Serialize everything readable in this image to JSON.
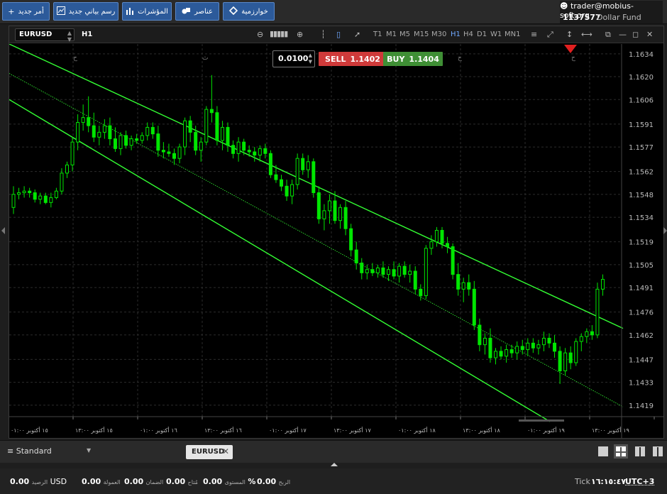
{
  "toolbar": {
    "buttons": [
      {
        "label": "أمر جديد",
        "icon": "+"
      },
      {
        "label": "رسم بياني جديد",
        "icon": "chart"
      },
      {
        "label": "المؤشرات",
        "icon": "bars"
      },
      {
        "label": "عناصر",
        "icon": "shapes"
      },
      {
        "label": "خوارزمية",
        "icon": "diamond"
      }
    ],
    "account_user": "trader@mobius-soft.org",
    "account_number": "1137577",
    "account_fund": "Dollar Fund"
  },
  "chart_window": {
    "symbol": "EURUSD",
    "timeframe": "H1",
    "timeframes": [
      "T1",
      "M1",
      "M5",
      "M15",
      "M30",
      "H1",
      "H4",
      "D1",
      "W1",
      "MN1"
    ],
    "selected_timeframe": "H1",
    "lot_value": "0.0100",
    "sell_label": "SELL",
    "sell_price": "1.1402",
    "buy_label": "BUY",
    "buy_price": "1.1404",
    "top_marks": [
      "ح",
      "ث",
      "ح",
      "ح"
    ]
  },
  "chart_data": {
    "type": "candlestick",
    "price_ticks": [
      "1.1634",
      "1.1620",
      "1.1606",
      "1.1591",
      "1.1577",
      "1.1562",
      "1.1548",
      "1.1534",
      "1.1519",
      "1.1505",
      "1.1491",
      "1.1476",
      "1.1462",
      "1.1447",
      "1.1433",
      "1.1419"
    ],
    "ylim": [
      1.1412,
      1.164
    ],
    "time_labels": [
      "١٥ أكتوبر ٠١:٠٠",
      "١٥ أكتوبر ١٣:٠٠",
      "١٦ أكتوبر ٠١:٠٠",
      "١٦ أكتوبر ١٣:٠٠",
      "١٧ أكتوبر ٠١:٠٠",
      "١٧ أكتوبر ١٣:٠٠",
      "١٨ أكتوبر ٠١:٠٠",
      "١٨ أكتوبر ١٣:٠٠",
      "١٩ أكتوبر ٠١:٠٠",
      "١٩ أكتوبر ١٣:٠٠"
    ],
    "candles": [
      [
        1.154,
        1.1553,
        1.1536,
        1.1548
      ],
      [
        1.1548,
        1.1552,
        1.1545,
        1.1549
      ],
      [
        1.1549,
        1.1553,
        1.1546,
        1.155
      ],
      [
        1.155,
        1.1552,
        1.1546,
        1.1549
      ],
      [
        1.1549,
        1.1551,
        1.1543,
        1.1545
      ],
      [
        1.1545,
        1.1549,
        1.1542,
        1.1547
      ],
      [
        1.1547,
        1.1549,
        1.1542,
        1.1543
      ],
      [
        1.1543,
        1.1549,
        1.154,
        1.1546
      ],
      [
        1.1546,
        1.1552,
        1.1545,
        1.155
      ],
      [
        1.155,
        1.1564,
        1.1548,
        1.1561
      ],
      [
        1.1561,
        1.1568,
        1.1558,
        1.1566
      ],
      [
        1.1566,
        1.1583,
        1.1562,
        1.158
      ],
      [
        1.158,
        1.1597,
        1.1575,
        1.1592
      ],
      [
        1.1592,
        1.1603,
        1.1587,
        1.1595
      ],
      [
        1.1595,
        1.1608,
        1.1586,
        1.159
      ],
      [
        1.159,
        1.1598,
        1.158,
        1.1583
      ],
      [
        1.1583,
        1.159,
        1.1578,
        1.1586
      ],
      [
        1.1586,
        1.1594,
        1.1582,
        1.159
      ],
      [
        1.159,
        1.1595,
        1.1578,
        1.1582
      ],
      [
        1.1582,
        1.1589,
        1.1574,
        1.1576
      ],
      [
        1.1576,
        1.1586,
        1.1572,
        1.1584
      ],
      [
        1.1584,
        1.1587,
        1.1576,
        1.1578
      ],
      [
        1.1578,
        1.1584,
        1.1575,
        1.1582
      ],
      [
        1.1582,
        1.1585,
        1.1579,
        1.1581
      ],
      [
        1.1581,
        1.1586,
        1.1579,
        1.1584
      ],
      [
        1.1584,
        1.1592,
        1.1581,
        1.1589
      ],
      [
        1.1589,
        1.1592,
        1.1582,
        1.1585
      ],
      [
        1.1585,
        1.159,
        1.1571,
        1.1575
      ],
      [
        1.1575,
        1.158,
        1.157,
        1.1574
      ],
      [
        1.1574,
        1.1579,
        1.1571,
        1.1573
      ],
      [
        1.1573,
        1.1576,
        1.1566,
        1.157
      ],
      [
        1.157,
        1.1579,
        1.1567,
        1.1577
      ],
      [
        1.1577,
        1.1595,
        1.1572,
        1.1593
      ],
      [
        1.1593,
        1.1596,
        1.158,
        1.1586
      ],
      [
        1.1586,
        1.159,
        1.1572,
        1.1575
      ],
      [
        1.1575,
        1.1583,
        1.1568,
        1.158
      ],
      [
        1.158,
        1.1602,
        1.1578,
        1.16
      ],
      [
        1.16,
        1.1621,
        1.1592,
        1.1598
      ],
      [
        1.1598,
        1.1602,
        1.1578,
        1.1581
      ],
      [
        1.1581,
        1.1593,
        1.1575,
        1.1589
      ],
      [
        1.1589,
        1.1592,
        1.1574,
        1.1578
      ],
      [
        1.1578,
        1.1581,
        1.157,
        1.1573
      ],
      [
        1.1573,
        1.1583,
        1.1568,
        1.158
      ],
      [
        1.158,
        1.1582,
        1.1572,
        1.1575
      ],
      [
        1.1575,
        1.1578,
        1.1571,
        1.1574
      ],
      [
        1.1574,
        1.1577,
        1.1568,
        1.1572
      ],
      [
        1.1572,
        1.1578,
        1.1568,
        1.1576
      ],
      [
        1.1576,
        1.1579,
        1.157,
        1.1573
      ],
      [
        1.1573,
        1.1575,
        1.1558,
        1.156
      ],
      [
        1.156,
        1.1566,
        1.1555,
        1.1557
      ],
      [
        1.1557,
        1.156,
        1.155,
        1.1553
      ],
      [
        1.1553,
        1.1557,
        1.1544,
        1.1547
      ],
      [
        1.1547,
        1.1557,
        1.1542,
        1.1554
      ],
      [
        1.1554,
        1.1573,
        1.1551,
        1.157
      ],
      [
        1.157,
        1.1573,
        1.156,
        1.1563
      ],
      [
        1.1563,
        1.1572,
        1.1558,
        1.1568
      ],
      [
        1.1568,
        1.157,
        1.1546,
        1.1549
      ],
      [
        1.1549,
        1.1553,
        1.153,
        1.1533
      ],
      [
        1.1533,
        1.1542,
        1.1526,
        1.1538
      ],
      [
        1.1538,
        1.1548,
        1.153,
        1.1544
      ],
      [
        1.1544,
        1.155,
        1.153,
        1.1532
      ],
      [
        1.1532,
        1.1542,
        1.1527,
        1.154
      ],
      [
        1.154,
        1.1544,
        1.1523,
        1.1527
      ],
      [
        1.1527,
        1.153,
        1.151,
        1.1514
      ],
      [
        1.1514,
        1.1519,
        1.1502,
        1.1506
      ],
      [
        1.1506,
        1.1509,
        1.1496,
        1.15
      ],
      [
        1.15,
        1.1505,
        1.1496,
        1.1502
      ],
      [
        1.1502,
        1.1506,
        1.1498,
        1.15
      ],
      [
        1.15,
        1.1505,
        1.1497,
        1.1503
      ],
      [
        1.1503,
        1.1507,
        1.1497,
        1.1499
      ],
      [
        1.1499,
        1.1504,
        1.1495,
        1.1502
      ],
      [
        1.1502,
        1.1507,
        1.1496,
        1.1498
      ],
      [
        1.1498,
        1.1506,
        1.1494,
        1.1504
      ],
      [
        1.1504,
        1.1507,
        1.1497,
        1.1499
      ],
      [
        1.1499,
        1.1505,
        1.1494,
        1.1501
      ],
      [
        1.1501,
        1.1504,
        1.1487,
        1.149
      ],
      [
        1.149,
        1.1493,
        1.1483,
        1.1486
      ],
      [
        1.1486,
        1.1517,
        1.1484,
        1.1515
      ],
      [
        1.1515,
        1.1523,
        1.1511,
        1.1519
      ],
      [
        1.1519,
        1.1528,
        1.1516,
        1.1526
      ],
      [
        1.1526,
        1.1528,
        1.1515,
        1.1518
      ],
      [
        1.1518,
        1.1522,
        1.1512,
        1.1516
      ],
      [
        1.1516,
        1.1518,
        1.1496,
        1.1499
      ],
      [
        1.1499,
        1.1506,
        1.1486,
        1.149
      ],
      [
        1.149,
        1.1497,
        1.1482,
        1.1494
      ],
      [
        1.1494,
        1.1499,
        1.1486,
        1.149
      ],
      [
        1.149,
        1.1495,
        1.1465,
        1.1468
      ],
      [
        1.1468,
        1.1472,
        1.1452,
        1.1456
      ],
      [
        1.1456,
        1.1463,
        1.145,
        1.146
      ],
      [
        1.146,
        1.1466,
        1.1445,
        1.1448
      ],
      [
        1.1448,
        1.1454,
        1.1444,
        1.1452
      ],
      [
        1.1452,
        1.1455,
        1.1447,
        1.1449
      ],
      [
        1.1449,
        1.1456,
        1.1445,
        1.1453
      ],
      [
        1.1453,
        1.1456,
        1.1448,
        1.1451
      ],
      [
        1.1451,
        1.1458,
        1.1447,
        1.1455
      ],
      [
        1.1455,
        1.1459,
        1.145,
        1.1453
      ],
      [
        1.1453,
        1.146,
        1.1449,
        1.1457
      ],
      [
        1.1457,
        1.146,
        1.1451,
        1.1454
      ],
      [
        1.1454,
        1.1459,
        1.145,
        1.1456
      ],
      [
        1.1456,
        1.1464,
        1.1452,
        1.146
      ],
      [
        1.146,
        1.1463,
        1.1454,
        1.1457
      ],
      [
        1.1457,
        1.1462,
        1.1448,
        1.1452
      ],
      [
        1.1452,
        1.1455,
        1.1432,
        1.144
      ],
      [
        1.144,
        1.1454,
        1.1437,
        1.1451
      ],
      [
        1.1451,
        1.1455,
        1.1441,
        1.1445
      ],
      [
        1.1445,
        1.146,
        1.1443,
        1.1458
      ],
      [
        1.1458,
        1.1463,
        1.1452,
        1.1461
      ],
      [
        1.1461,
        1.1466,
        1.1457,
        1.1464
      ],
      [
        1.1464,
        1.1468,
        1.1459,
        1.1462
      ],
      [
        1.1462,
        1.1494,
        1.146,
        1.149
      ],
      [
        1.149,
        1.1499,
        1.1486,
        1.1496
      ]
    ],
    "channels": [
      {
        "from": [
          0,
          1.164
        ],
        "to": [
          865,
          1.1466
        ]
      },
      {
        "from": [
          0,
          1.1606
        ],
        "to": [
          762,
          1.1409
        ]
      },
      {
        "from": [
          0,
          1.1622
        ],
        "to": [
          865,
          1.1418
        ]
      }
    ],
    "colors": {
      "candle": "#00e600",
      "channel": "#33ff33",
      "grid": "#2c2c2c",
      "ask_marker": "#e02020"
    }
  },
  "bottom_tabs": {
    "template": "Standard",
    "chart_tab": "EURUSD",
    "layouts": [
      "single",
      "grid",
      "columns",
      "rows"
    ]
  },
  "status": {
    "balance": "0.00",
    "balance_label": "الرصيد",
    "currency": "USD",
    "commission": "0.00",
    "commission_label": "العمولة",
    "margin": "0.00",
    "margin_label": "الضمان",
    "available_label": "مُتاح",
    "level": "0.00",
    "level_label": "المستوى",
    "percent": "%",
    "profit": "0.00",
    "profit_label": "الربح",
    "tick_label": "Tick",
    "clock": "١٦:١٥:٤٧",
    "timezone": "UTC+3"
  }
}
